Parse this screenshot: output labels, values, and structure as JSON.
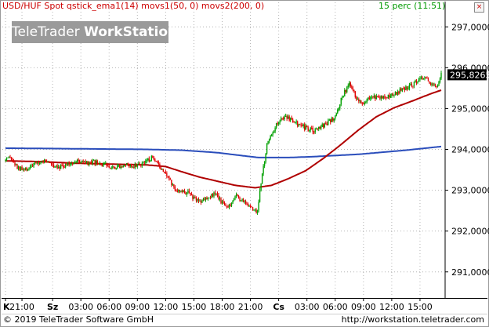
{
  "header": {
    "symbol_info": "USD/HUF Spot qstick_ema1(14) movs1(50, 0) movs2(200, 0)",
    "interval": "15 perc (11:51)",
    "close_label": "×"
  },
  "watermark": {
    "prefix": "TeleTrader ",
    "brand": "WorkStation"
  },
  "footer": {
    "copyright": "© 2019 TeleTrader Software GmbH",
    "url": "http://workstation.teletrader.com"
  },
  "colors": {
    "candle_up": "#00a000",
    "candle_down": "#e00000",
    "movs1": "#b00000",
    "movs2": "#2a4dbb",
    "grid": "#b4b4b4",
    "price_box": "#000000",
    "watermark_bg": "#9a9a9a"
  },
  "chart_data": {
    "type": "candlestick",
    "title": "USD/HUF Spot",
    "ylim": [
      290.4,
      297.6
    ],
    "y_ticks": [
      "297,0000",
      "296,0000",
      "295,0000",
      "294,0000",
      "293,0000",
      "292,0000",
      "291,0000"
    ],
    "y_tick_values": [
      297,
      296,
      295,
      294,
      293,
      292,
      291
    ],
    "x_ticks": [
      "K",
      "21:00",
      "Sz",
      "03:00",
      "06:00",
      "09:00",
      "12:00",
      "15:00",
      "18:00",
      "21:00",
      "Cs",
      "03:00",
      "06:00",
      "09:00",
      "12:00",
      "15:00"
    ],
    "x_tick_bold": [
      true,
      false,
      true,
      false,
      false,
      false,
      false,
      false,
      false,
      false,
      true,
      false,
      false,
      false,
      false,
      false
    ],
    "x_tick_index": [
      0,
      14,
      40,
      64,
      88,
      112,
      136,
      160,
      184,
      208,
      232,
      256,
      280,
      304,
      328,
      352
    ],
    "n_bars": 371,
    "last_price": "295,8265",
    "last_value": 295.8265,
    "series": [
      {
        "name": "price",
        "type": "candles",
        "anchors": [
          [
            0,
            293.72
          ],
          [
            4,
            293.78
          ],
          [
            10,
            293.55
          ],
          [
            16,
            293.48
          ],
          [
            22,
            293.6
          ],
          [
            28,
            293.68
          ],
          [
            34,
            293.72
          ],
          [
            40,
            293.62
          ],
          [
            46,
            293.58
          ],
          [
            52,
            293.62
          ],
          [
            58,
            293.7
          ],
          [
            64,
            293.7
          ],
          [
            70,
            293.64
          ],
          [
            76,
            293.68
          ],
          [
            82,
            293.62
          ],
          [
            88,
            293.6
          ],
          [
            94,
            293.58
          ],
          [
            100,
            293.62
          ],
          [
            106,
            293.6
          ],
          [
            112,
            293.62
          ],
          [
            118,
            293.68
          ],
          [
            124,
            293.78
          ],
          [
            130,
            293.6
          ],
          [
            136,
            293.45
          ],
          [
            142,
            293.1
          ],
          [
            148,
            292.95
          ],
          [
            154,
            292.95
          ],
          [
            160,
            292.82
          ],
          [
            166,
            292.72
          ],
          [
            172,
            292.85
          ],
          [
            178,
            292.9
          ],
          [
            184,
            292.7
          ],
          [
            190,
            292.62
          ],
          [
            196,
            292.88
          ],
          [
            202,
            292.72
          ],
          [
            208,
            292.6
          ],
          [
            211,
            292.48
          ],
          [
            214,
            292.5
          ],
          [
            218,
            293.4
          ],
          [
            222,
            294.1
          ],
          [
            226,
            294.4
          ],
          [
            232,
            294.7
          ],
          [
            238,
            294.82
          ],
          [
            244,
            294.68
          ],
          [
            250,
            294.6
          ],
          [
            256,
            294.5
          ],
          [
            262,
            294.45
          ],
          [
            268,
            294.55
          ],
          [
            274,
            294.65
          ],
          [
            280,
            294.8
          ],
          [
            286,
            295.3
          ],
          [
            292,
            295.6
          ],
          [
            298,
            295.25
          ],
          [
            304,
            295.15
          ],
          [
            310,
            295.3
          ],
          [
            316,
            295.28
          ],
          [
            322,
            295.25
          ],
          [
            328,
            295.35
          ],
          [
            334,
            295.42
          ],
          [
            340,
            295.5
          ],
          [
            346,
            295.6
          ],
          [
            352,
            295.75
          ],
          [
            356,
            295.72
          ],
          [
            360,
            295.65
          ],
          [
            364,
            295.6
          ],
          [
            367,
            295.55
          ],
          [
            370,
            295.9
          ],
          [
            374,
            296.2
          ],
          [
            378,
            296.35
          ],
          [
            382,
            296.42
          ],
          [
            386,
            296.3
          ],
          [
            390,
            296.1
          ],
          [
            394,
            296.05
          ],
          [
            398,
            296.0
          ],
          [
            402,
            295.82
          ]
        ]
      },
      {
        "name": "movs1(50, 0)",
        "type": "line",
        "anchors": [
          [
            0,
            293.72
          ],
          [
            30,
            293.7
          ],
          [
            60,
            293.66
          ],
          [
            90,
            293.64
          ],
          [
            120,
            293.62
          ],
          [
            136,
            293.58
          ],
          [
            150,
            293.45
          ],
          [
            165,
            293.32
          ],
          [
            180,
            293.22
          ],
          [
            195,
            293.12
          ],
          [
            212,
            293.06
          ],
          [
            226,
            293.12
          ],
          [
            240,
            293.28
          ],
          [
            255,
            293.48
          ],
          [
            270,
            293.78
          ],
          [
            285,
            294.12
          ],
          [
            300,
            294.48
          ],
          [
            315,
            294.8
          ],
          [
            330,
            295.02
          ],
          [
            345,
            295.18
          ],
          [
            360,
            295.35
          ],
          [
            375,
            295.5
          ],
          [
            385,
            295.57
          ],
          [
            398,
            295.63
          ]
        ]
      },
      {
        "name": "movs2(200, 0)",
        "type": "line",
        "anchors": [
          [
            0,
            294.03
          ],
          [
            40,
            294.02
          ],
          [
            80,
            294.01
          ],
          [
            120,
            294.0
          ],
          [
            150,
            293.98
          ],
          [
            180,
            293.92
          ],
          [
            200,
            293.85
          ],
          [
            215,
            293.8
          ],
          [
            240,
            293.8
          ],
          [
            260,
            293.82
          ],
          [
            280,
            293.85
          ],
          [
            300,
            293.88
          ],
          [
            320,
            293.93
          ],
          [
            340,
            293.98
          ],
          [
            360,
            294.04
          ],
          [
            380,
            294.1
          ],
          [
            398,
            294.16
          ]
        ]
      }
    ]
  }
}
